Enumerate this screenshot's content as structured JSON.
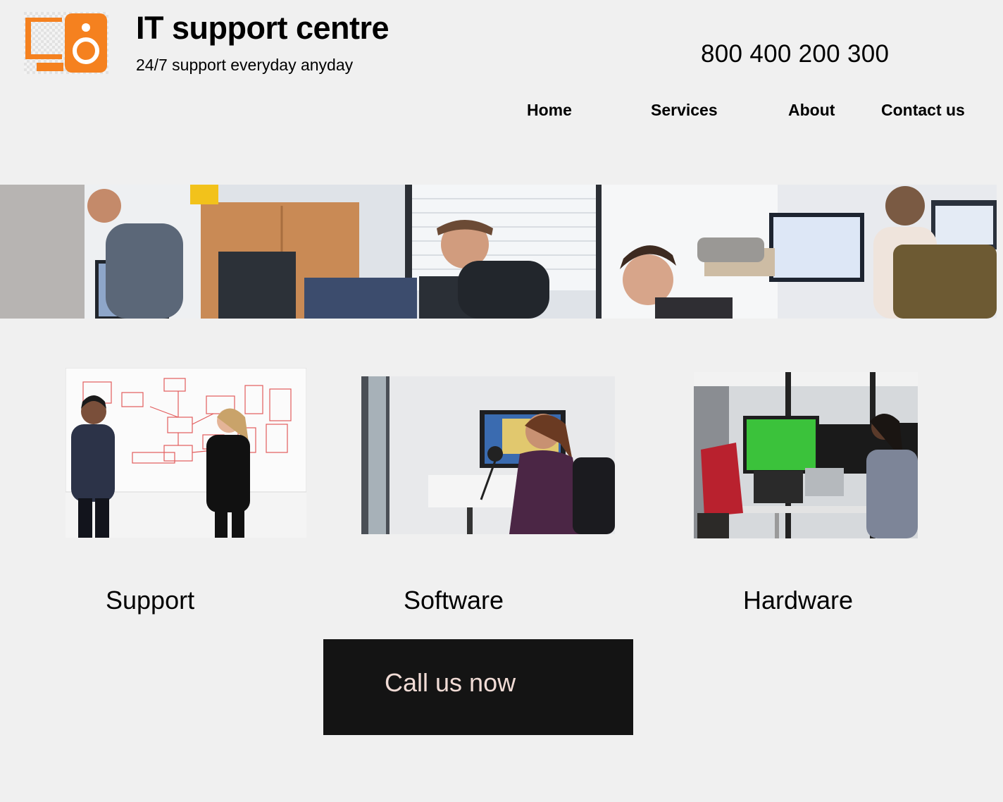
{
  "header": {
    "title": "IT support centre",
    "tagline": "24/7 support everyday anyday",
    "phone": "800 400 200 300",
    "logo_icon": "computer-speaker-logo",
    "accent_color": "#f5811f"
  },
  "nav": {
    "items": [
      {
        "label": "Home"
      },
      {
        "label": "Services"
      },
      {
        "label": "About"
      },
      {
        "label": "Contact us"
      }
    ]
  },
  "hero": {
    "image": "office-team-at-computers-photo"
  },
  "services": [
    {
      "label": "Support",
      "image": "whiteboard-discussion-photo"
    },
    {
      "label": "Software",
      "image": "woman-at-desk-with-microphone-photo"
    },
    {
      "label": "Hardware",
      "image": "people-at-green-screen-monitors-photo"
    }
  ],
  "cta": {
    "label": "Call us now",
    "background": "#141414",
    "text_color": "#f1dcd6"
  }
}
